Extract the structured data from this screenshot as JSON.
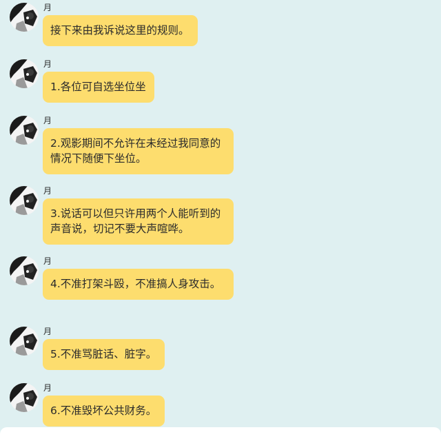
{
  "chat": {
    "messages": [
      {
        "sender": "月",
        "text": "接下来由我诉说这里的规则。"
      },
      {
        "sender": "月",
        "text": "1.各位可自选坐位坐"
      },
      {
        "sender": "月",
        "text": "2.观影期间不允许在未经过我同意的情况下随便下坐位。"
      },
      {
        "sender": "月",
        "text": "3.说话可以但只许用两个人能听到的声音说，切记不要大声喧哗。"
      },
      {
        "sender": "月",
        "text": "4.不准打架斗殴，不准搞人身攻击。"
      },
      {
        "sender": "月",
        "text": "5.不准骂脏话、脏字。"
      },
      {
        "sender": "月",
        "text": "6.不准毁坏公共财务。"
      }
    ]
  },
  "colors": {
    "background": "#dff0f1",
    "bubble": "#fddd6e",
    "input_bar": "#ffffff"
  },
  "icons": {
    "avatar": "user-avatar-icon"
  }
}
